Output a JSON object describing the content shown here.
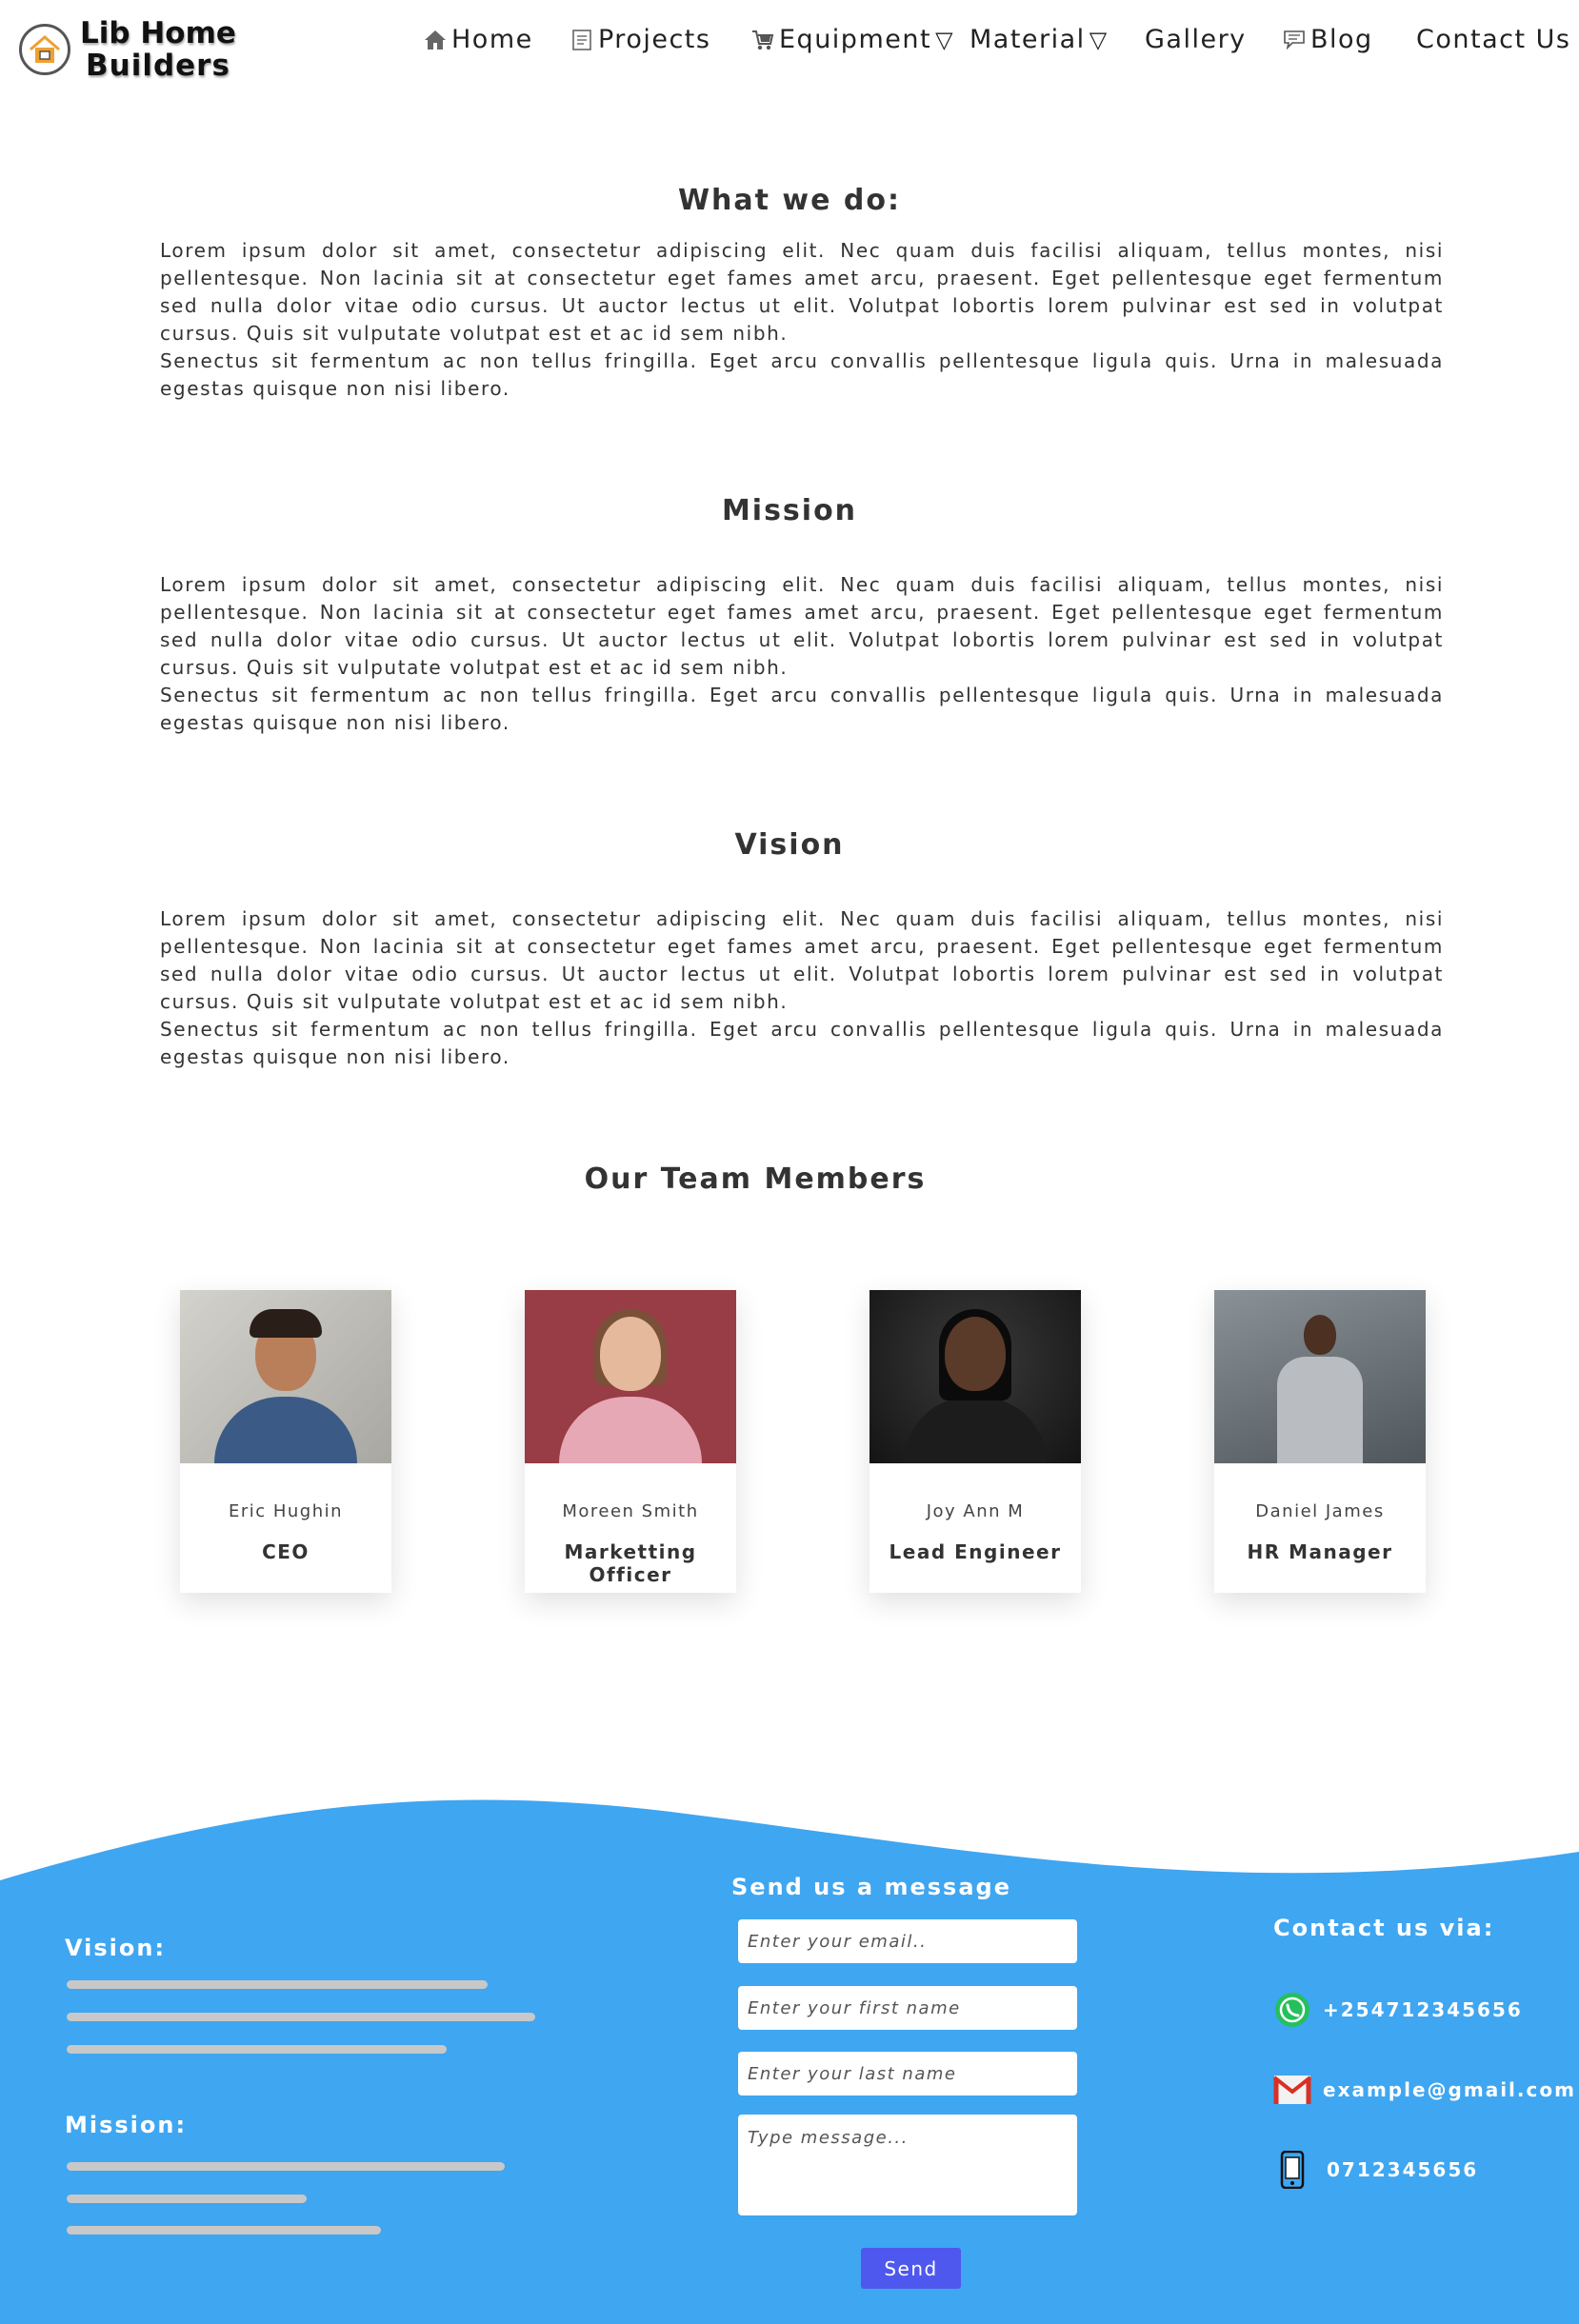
{
  "brand": {
    "line1": "Lib Home",
    "line2": "Builders"
  },
  "nav": {
    "home": "Home",
    "projects": "Projects",
    "equipment": "Equipment",
    "material": "Material",
    "gallery": "Gallery",
    "blog": "Blog",
    "contact": "Contact Us",
    "caret": "▽"
  },
  "sections": {
    "what": {
      "title": "What we do:",
      "p1": "Lorem ipsum dolor sit amet, consectetur adipiscing elit. Nec quam duis facilisi aliquam, tellus montes, nisi pellentesque. Non lacinia sit at consectetur eget fames amet arcu, praesent. Eget pellentesque eget fermentum sed nulla dolor vitae odio cursus. Ut auctor lectus ut elit. Volutpat lobortis lorem pulvinar est sed in volutpat cursus. Quis sit vulputate volutpat est et ac id sem nibh.",
      "p2": "Senectus sit fermentum ac non tellus fringilla. Eget arcu convallis pellentesque ligula quis. Urna in malesuada egestas quisque non nisi libero."
    },
    "mission": {
      "title": "Mission",
      "p1": "Lorem ipsum dolor sit amet, consectetur adipiscing elit. Nec quam duis facilisi aliquam, tellus montes, nisi pellentesque. Non lacinia sit at consectetur eget fames amet arcu, praesent. Eget pellentesque eget fermentum sed nulla dolor vitae odio cursus. Ut auctor lectus ut elit. Volutpat lobortis lorem pulvinar est sed in volutpat cursus. Quis sit vulputate volutpat est et ac id sem nibh.",
      "p2": "Senectus sit fermentum ac non tellus fringilla. Eget arcu convallis pellentesque ligula quis. Urna in malesuada egestas quisque non nisi libero."
    },
    "vision": {
      "title": "Vision",
      "p1": "Lorem ipsum dolor sit amet, consectetur adipiscing elit. Nec quam duis facilisi aliquam, tellus montes, nisi pellentesque. Non lacinia sit at consectetur eget fames amet arcu, praesent. Eget pellentesque eget fermentum sed nulla dolor vitae odio cursus. Ut auctor lectus ut elit. Volutpat lobortis lorem pulvinar est sed in volutpat cursus. Quis sit vulputate volutpat est et ac id sem nibh.",
      "p2": "Senectus sit fermentum ac non tellus fringilla. Eget arcu convallis pellentesque ligula quis. Urna in malesuada egestas quisque non nisi libero."
    }
  },
  "team": {
    "title": "Our Team Members",
    "members": [
      {
        "name": "Eric Hughin",
        "role": "CEO"
      },
      {
        "name": "Moreen Smith",
        "role": "Marketting Officer"
      },
      {
        "name": "Joy Ann  M",
        "role": "Lead Engineer"
      },
      {
        "name": "Daniel James",
        "role": "HR Manager"
      }
    ]
  },
  "footer": {
    "vision_title": "Vision:",
    "mission_title": "Mission:",
    "form": {
      "title": "Send us a message",
      "email_placeholder": "Enter your email..",
      "first_placeholder": "Enter your first name",
      "last_placeholder": "Enter your last name",
      "message_placeholder": "Type message...",
      "send_label": "Send"
    },
    "contact": {
      "title": "Contact us via:",
      "whatsapp": "+254712345656",
      "email": "example@gmail.com",
      "phone": "0712345656"
    }
  },
  "colors": {
    "footer_blue": "#3fa6f1",
    "send_button": "#4e58ee",
    "whatsapp": "#25c05b",
    "gmail_red": "#d93025",
    "logo_orange": "#f0a030"
  },
  "icons": {
    "home": "house-icon",
    "projects": "document-icon",
    "equipment": "cart-icon",
    "blog": "chat-icon"
  }
}
